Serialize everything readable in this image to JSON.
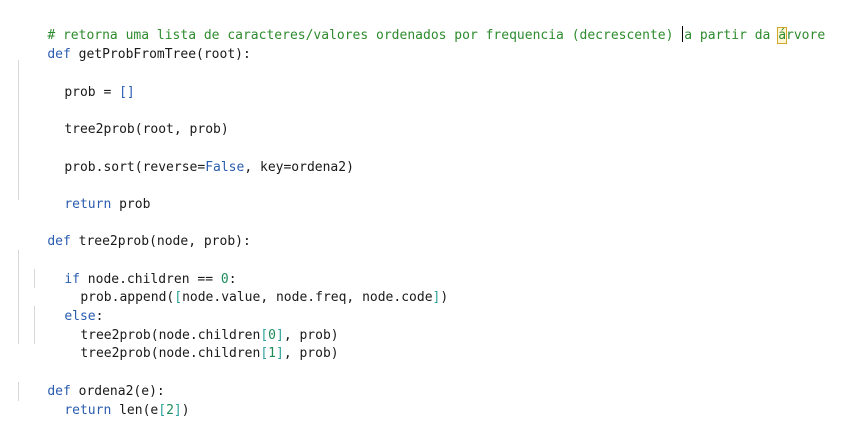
{
  "editor": {
    "lines": {
      "l01": {
        "a": "# retorna uma lista de caracteres/valores ordenados por frequencia (decrescente) ",
        "b": "a partir da ",
        "c": "á",
        "d": "rvore"
      },
      "l02": {
        "a": "def",
        "b": " getProbFromTree(root):"
      },
      "l04": {
        "a": "prob = ",
        "b": "[]"
      },
      "l06": {
        "a": "tree2prob(root, prob)"
      },
      "l08": {
        "a": "prob.sort(reverse=",
        "b": "False",
        "c": ", key=ordena2)"
      },
      "l10": {
        "a": "return",
        "b": " prob"
      },
      "l12": {
        "a": "def",
        "b": " tree2prob(node, prob):"
      },
      "l14": {
        "a": "if",
        "b": " node.children == ",
        "c": "0",
        "d": ":"
      },
      "l15": {
        "a": "prob.append(",
        "b": "[",
        "c": "node.value, node.freq, node.code",
        "d": "]",
        "e": ")"
      },
      "l16": {
        "a": "else",
        "b": ":"
      },
      "l17": {
        "a": "tree2prob(node.children",
        "b": "[",
        "c": "0",
        "d": "]",
        "e": ", prob)"
      },
      "l18": {
        "a": "tree2prob(node.children",
        "b": "[",
        "c": "1",
        "d": "]",
        "e": ", prob)"
      },
      "l20": {
        "a": "def",
        "b": " ordena2(e):"
      },
      "l21": {
        "a": "return",
        "b": " len(e",
        "c": "[",
        "d": "2",
        "e": "]",
        "f": ")"
      }
    }
  }
}
